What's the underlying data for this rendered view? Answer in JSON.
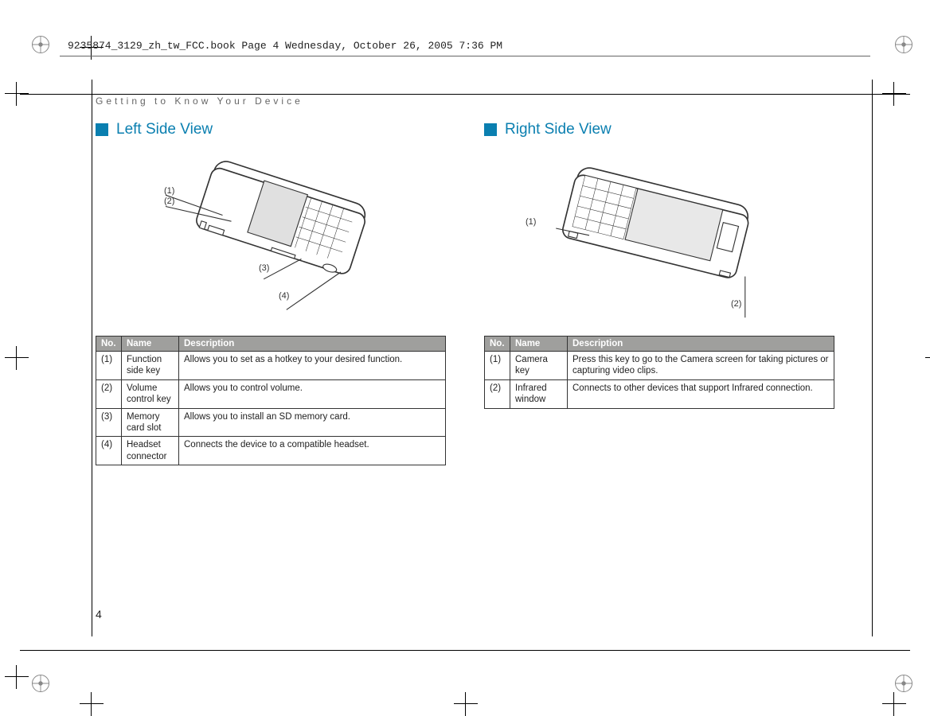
{
  "header_text": "9235874_3129_zh_tw_FCC.book  Page 4  Wednesday, October 26, 2005  7:36 PM",
  "breadcrumb": "Getting to Know Your Device",
  "page_number": "4",
  "left": {
    "title": "Left Side View",
    "callouts": {
      "c1": "(1)",
      "c2": "(2)",
      "c3": "(3)",
      "c4": "(4)"
    },
    "header": {
      "no": "No.",
      "name": "Name",
      "desc": "Description"
    },
    "rows": [
      {
        "no": "(1)",
        "name": "Function side key",
        "desc": "Allows you to set as a hotkey to your desired function."
      },
      {
        "no": "(2)",
        "name": "Volume control key",
        "desc": "Allows you to control volume."
      },
      {
        "no": "(3)",
        "name": "Memory card slot",
        "desc": "Allows you to install an SD memory card."
      },
      {
        "no": "(4)",
        "name": "Headset connector",
        "desc": "Connects the device to a compatible headset."
      }
    ]
  },
  "right": {
    "title": "Right Side View",
    "callouts": {
      "c1": "(1)",
      "c2": "(2)"
    },
    "header": {
      "no": "No.",
      "name": "Name",
      "desc": "Description"
    },
    "rows": [
      {
        "no": "(1)",
        "name": "Camera key",
        "desc": "Press this key to go to the Camera screen for taking pictures or capturing video clips."
      },
      {
        "no": "(2)",
        "name": "Infrared window",
        "desc": "Connects to other devices that support Infrared connection."
      }
    ]
  }
}
